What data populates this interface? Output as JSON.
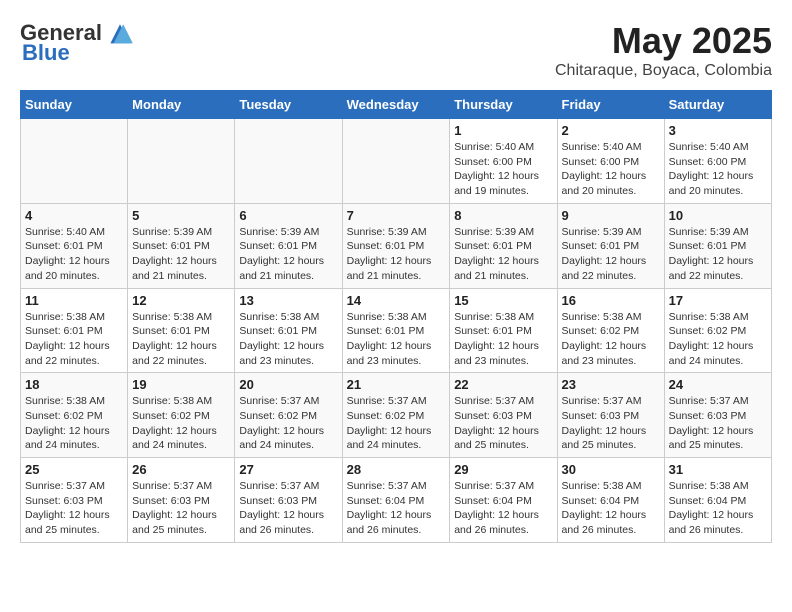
{
  "header": {
    "logo_general": "General",
    "logo_blue": "Blue",
    "month_title": "May 2025",
    "location": "Chitaraque, Boyaca, Colombia"
  },
  "weekdays": [
    "Sunday",
    "Monday",
    "Tuesday",
    "Wednesday",
    "Thursday",
    "Friday",
    "Saturday"
  ],
  "weeks": [
    [
      {
        "day": "",
        "info": ""
      },
      {
        "day": "",
        "info": ""
      },
      {
        "day": "",
        "info": ""
      },
      {
        "day": "",
        "info": ""
      },
      {
        "day": "1",
        "info": "Sunrise: 5:40 AM\nSunset: 6:00 PM\nDaylight: 12 hours\nand 19 minutes."
      },
      {
        "day": "2",
        "info": "Sunrise: 5:40 AM\nSunset: 6:00 PM\nDaylight: 12 hours\nand 20 minutes."
      },
      {
        "day": "3",
        "info": "Sunrise: 5:40 AM\nSunset: 6:00 PM\nDaylight: 12 hours\nand 20 minutes."
      }
    ],
    [
      {
        "day": "4",
        "info": "Sunrise: 5:40 AM\nSunset: 6:01 PM\nDaylight: 12 hours\nand 20 minutes."
      },
      {
        "day": "5",
        "info": "Sunrise: 5:39 AM\nSunset: 6:01 PM\nDaylight: 12 hours\nand 21 minutes."
      },
      {
        "day": "6",
        "info": "Sunrise: 5:39 AM\nSunset: 6:01 PM\nDaylight: 12 hours\nand 21 minutes."
      },
      {
        "day": "7",
        "info": "Sunrise: 5:39 AM\nSunset: 6:01 PM\nDaylight: 12 hours\nand 21 minutes."
      },
      {
        "day": "8",
        "info": "Sunrise: 5:39 AM\nSunset: 6:01 PM\nDaylight: 12 hours\nand 21 minutes."
      },
      {
        "day": "9",
        "info": "Sunrise: 5:39 AM\nSunset: 6:01 PM\nDaylight: 12 hours\nand 22 minutes."
      },
      {
        "day": "10",
        "info": "Sunrise: 5:39 AM\nSunset: 6:01 PM\nDaylight: 12 hours\nand 22 minutes."
      }
    ],
    [
      {
        "day": "11",
        "info": "Sunrise: 5:38 AM\nSunset: 6:01 PM\nDaylight: 12 hours\nand 22 minutes."
      },
      {
        "day": "12",
        "info": "Sunrise: 5:38 AM\nSunset: 6:01 PM\nDaylight: 12 hours\nand 22 minutes."
      },
      {
        "day": "13",
        "info": "Sunrise: 5:38 AM\nSunset: 6:01 PM\nDaylight: 12 hours\nand 23 minutes."
      },
      {
        "day": "14",
        "info": "Sunrise: 5:38 AM\nSunset: 6:01 PM\nDaylight: 12 hours\nand 23 minutes."
      },
      {
        "day": "15",
        "info": "Sunrise: 5:38 AM\nSunset: 6:01 PM\nDaylight: 12 hours\nand 23 minutes."
      },
      {
        "day": "16",
        "info": "Sunrise: 5:38 AM\nSunset: 6:02 PM\nDaylight: 12 hours\nand 23 minutes."
      },
      {
        "day": "17",
        "info": "Sunrise: 5:38 AM\nSunset: 6:02 PM\nDaylight: 12 hours\nand 24 minutes."
      }
    ],
    [
      {
        "day": "18",
        "info": "Sunrise: 5:38 AM\nSunset: 6:02 PM\nDaylight: 12 hours\nand 24 minutes."
      },
      {
        "day": "19",
        "info": "Sunrise: 5:38 AM\nSunset: 6:02 PM\nDaylight: 12 hours\nand 24 minutes."
      },
      {
        "day": "20",
        "info": "Sunrise: 5:37 AM\nSunset: 6:02 PM\nDaylight: 12 hours\nand 24 minutes."
      },
      {
        "day": "21",
        "info": "Sunrise: 5:37 AM\nSunset: 6:02 PM\nDaylight: 12 hours\nand 24 minutes."
      },
      {
        "day": "22",
        "info": "Sunrise: 5:37 AM\nSunset: 6:03 PM\nDaylight: 12 hours\nand 25 minutes."
      },
      {
        "day": "23",
        "info": "Sunrise: 5:37 AM\nSunset: 6:03 PM\nDaylight: 12 hours\nand 25 minutes."
      },
      {
        "day": "24",
        "info": "Sunrise: 5:37 AM\nSunset: 6:03 PM\nDaylight: 12 hours\nand 25 minutes."
      }
    ],
    [
      {
        "day": "25",
        "info": "Sunrise: 5:37 AM\nSunset: 6:03 PM\nDaylight: 12 hours\nand 25 minutes."
      },
      {
        "day": "26",
        "info": "Sunrise: 5:37 AM\nSunset: 6:03 PM\nDaylight: 12 hours\nand 25 minutes."
      },
      {
        "day": "27",
        "info": "Sunrise: 5:37 AM\nSunset: 6:03 PM\nDaylight: 12 hours\nand 26 minutes."
      },
      {
        "day": "28",
        "info": "Sunrise: 5:37 AM\nSunset: 6:04 PM\nDaylight: 12 hours\nand 26 minutes."
      },
      {
        "day": "29",
        "info": "Sunrise: 5:37 AM\nSunset: 6:04 PM\nDaylight: 12 hours\nand 26 minutes."
      },
      {
        "day": "30",
        "info": "Sunrise: 5:38 AM\nSunset: 6:04 PM\nDaylight: 12 hours\nand 26 minutes."
      },
      {
        "day": "31",
        "info": "Sunrise: 5:38 AM\nSunset: 6:04 PM\nDaylight: 12 hours\nand 26 minutes."
      }
    ]
  ]
}
